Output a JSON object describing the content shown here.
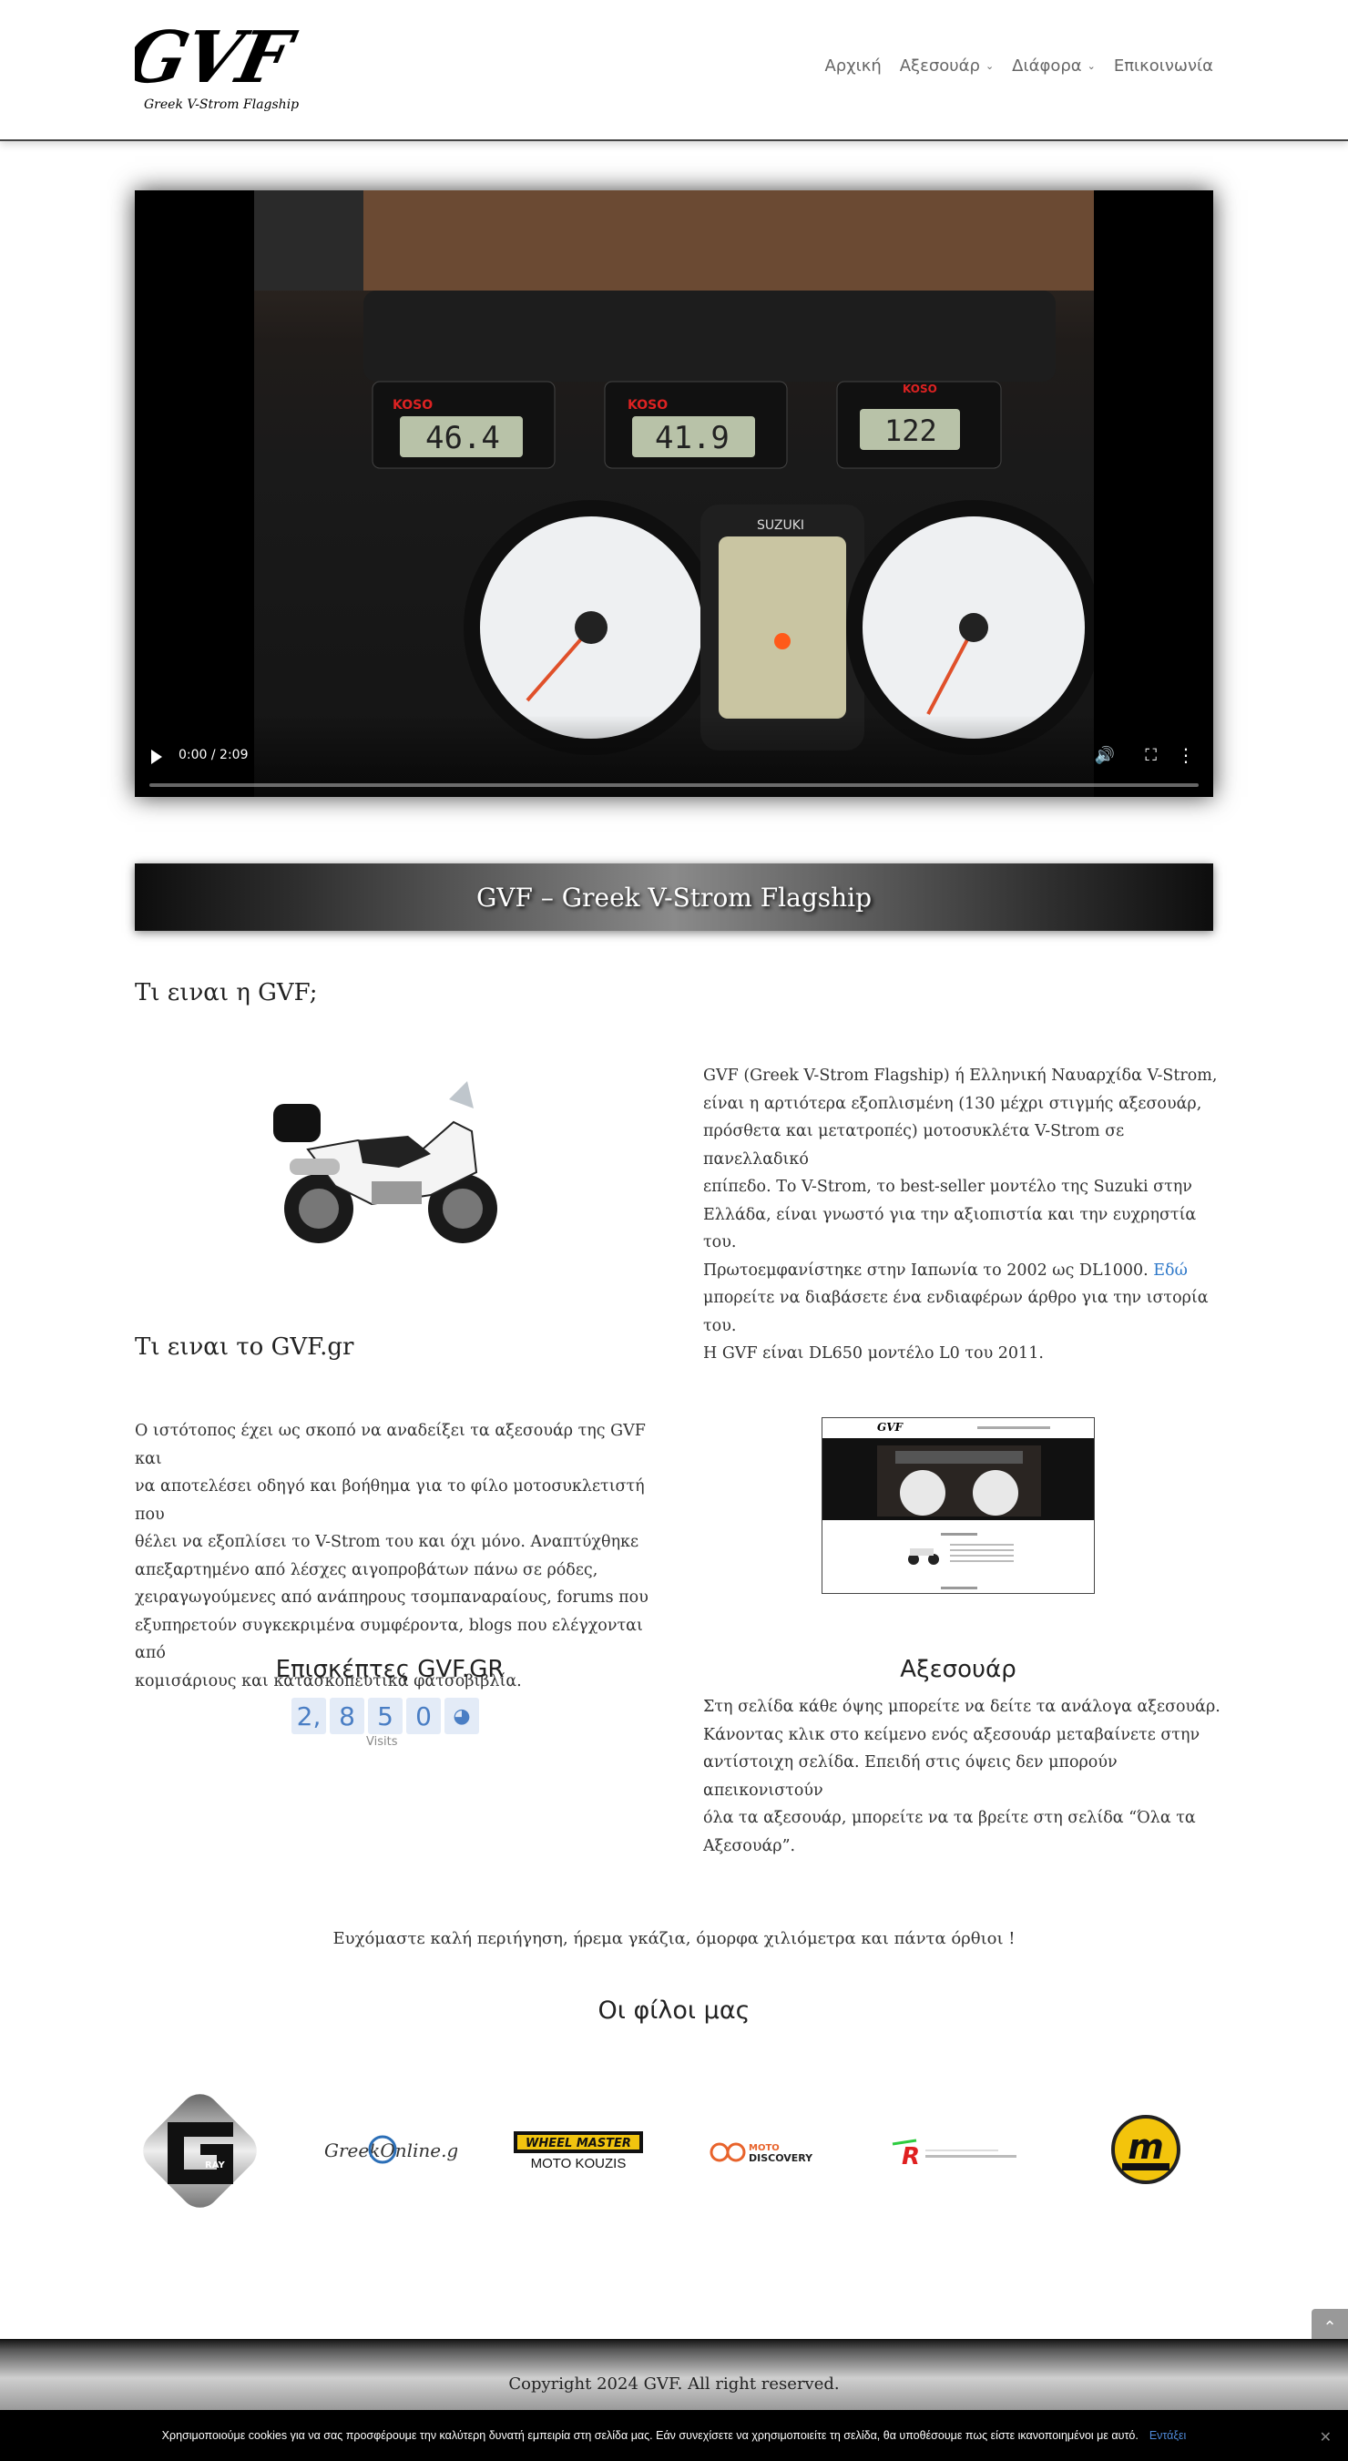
{
  "header": {
    "logo_text": "GVF",
    "logo_subtext": "Greek V-Strom Flagship",
    "nav": [
      {
        "label": "Αρχική",
        "has_dropdown": false
      },
      {
        "label": "Αξεσουάρ",
        "has_dropdown": true
      },
      {
        "label": "Διάφορα",
        "has_dropdown": true
      },
      {
        "label": "Επικοινωνία",
        "has_dropdown": false
      }
    ]
  },
  "video": {
    "time": "0:00 / 2:09",
    "gauge_readouts": [
      "46.4",
      "41.9",
      "122"
    ],
    "brand_labels": [
      "KOSO",
      "KOSO",
      "KOSO",
      "SUZUKI"
    ]
  },
  "banner": {
    "title": "GVF – Greek V-Strom Flagship"
  },
  "section1": {
    "heading": "Τι ειναι η GVF;",
    "text_lines": [
      "GVF (Greek V-Strom Flagship) ή Ελληνική Ναυαρχίδα V-Strom,",
      "είναι η αρτιότερα εξοπλισμένη (130 μέχρι στιγμής αξεσουάρ,",
      "πρόσθετα και μετατροπές) μοτοσυκλέτα V-Strom σε πανελλαδικό",
      "επίπεδο. Το V-Strom, το best-seller μοντέλο της Suzuki στην",
      "Ελλάδα, είναι γνωστό για την αξιοπιστία και την ευχρηστία του.",
      "Πρωτοεμφανίστηκε στην Ιαπωνία το 2002 ως DL1000.",
      "μπορείτε να διαβάσετε ένα ενδιαφέρων άρθρο για την ιστορία του.",
      "Η GVF είναι DL650 μοντέλο L0 του 2011."
    ],
    "link_label": "Εδώ"
  },
  "section2": {
    "heading": "Τι ειναι το GVF.gr",
    "text_lines": [
      "Ο ιστότοπος έχει ως σκοπό να αναδείξει τα αξεσουάρ της GVF και",
      "να αποτελέσει οδηγό και βοήθημα για το φίλο μοτοσυκλετιστή που",
      "θέλει να εξοπλίσει το V-Strom του και όχι μόνο. Αναπτύχθηκε",
      "απεξαρτημένο από λέσχες αιγοπροβάτων πάνω σε ρόδες,",
      "χειραγωγούμενες από ανάπηρους τσομπαναραίους, forums που",
      "εξυπηρετούν συγκεκριμένα συμφέροντα, blogs που ελέγχονται από",
      "κομισάριους και κατασκοπευτικά φατσοβιβλία."
    ]
  },
  "visitors": {
    "title": "Επισκέπτες GVF.GR",
    "digits": [
      "2,",
      "8",
      "5",
      "0"
    ],
    "label": "Visits"
  },
  "accessories": {
    "title": "Αξεσουάρ",
    "text_lines": [
      "Στη σελίδα κάθε όψης μπορείτε να δείτε τα ανάλογα αξεσουάρ.",
      "Κάνοντας κλικ στο κείμενο ενός αξεσουάρ μεταβαίνετε στην",
      "αντίστοιχη σελίδα. Επειδή στις όψεις δεν μπορούν απεικονιστούν",
      "όλα τα αξεσουάρ, μπορείτε να τα βρείτε στη σελίδα “Όλα τα",
      "Αξεσουάρ”."
    ]
  },
  "wish": "Ευχόμαστε καλή περιήγηση, ήρεμα γκάζια, όμορφα χιλιόμετρα και πάντα όρθιοι !",
  "friends": {
    "title": "Οι φίλοι μας",
    "partners": [
      {
        "name": "gray",
        "text": "RAY"
      },
      {
        "name": "greekonline",
        "text": "GreekOnline.gr"
      },
      {
        "name": "wheelmaster",
        "text": "WHEEL MASTER",
        "sub": "MOTO KOUZIS"
      },
      {
        "name": "motodiscovery",
        "text_a": "MOTO",
        "text_b": "DISCOVERY"
      },
      {
        "name": "moto-r",
        "text": "R"
      },
      {
        "name": "m-logo",
        "text": "m"
      }
    ]
  },
  "footer": {
    "copyright": "Copyright 2024 GVF. All right reserved."
  },
  "cookie": {
    "text": "Χρησιμοποιούμε cookies για να σας προσφέρουμε την καλύτερη δυνατή εμπειρία στη σελίδα μας. Εάν συνεχίσετε να χρησιμοποιείτε τη σελίδα, θα υποθέσουμε πως είστε ικανοποιημένοι με αυτό.",
    "ok": "Εντάξει",
    "close": "✕"
  },
  "colors": {
    "link": "#2e78c9",
    "nav_text": "#666666",
    "counter_bg": "#e3ebf7",
    "counter_digit": "#4a7ec4"
  }
}
